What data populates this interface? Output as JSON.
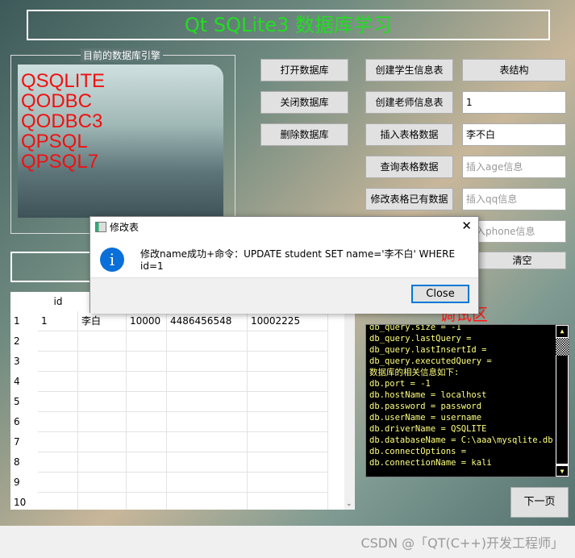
{
  "title": "Qt SQLite3 数据库学习",
  "engine_group": {
    "label": "目前的数据库引擎",
    "drivers": [
      "QSQLITE",
      "QODBC",
      "QODBC3",
      "QPSQL",
      "QPSQL7"
    ]
  },
  "buttons": {
    "open_db": "打开数据库",
    "close_db": "关闭数据库",
    "delete_db": "删除数据库",
    "create_student": "创建学生信息表",
    "create_teacher": "创建老师信息表",
    "insert": "插入表格数据",
    "query": "查询表格数据",
    "update": "修改表格已有数据",
    "structure": "表结构",
    "clear": "清空",
    "next_page": "下一页"
  },
  "inputs": {
    "id": "1",
    "name": "李不白",
    "age_placeholder": "插入age信息",
    "qq_placeholder": "插入qq信息",
    "phone_placeholder": "插入phone信息"
  },
  "table": {
    "headers": [
      "id",
      "",
      "",
      "",
      ""
    ],
    "rows": [
      [
        "1",
        "李白",
        "10000",
        "4486456548",
        "10002225"
      ]
    ],
    "row_numbers": [
      "1",
      "2",
      "3",
      "4",
      "5",
      "6",
      "7",
      "8",
      "9",
      "10"
    ]
  },
  "debug": {
    "label": "调试区",
    "lines": [
      "db_query.size = -1",
      "db_query.lastQuery =",
      "db_query.lastInsertId =",
      "db_query.executedQuery =",
      "数据库的相关信息如下:",
      "db.port = -1",
      "db.hostName = localhost",
      "db.password = password",
      "db.userName = username",
      "db.driverName = QSQLITE",
      "db.databaseName = C:\\aaa\\mysqlite.db",
      "db.connectOptions =",
      "db.connectionName = kali"
    ]
  },
  "dialog": {
    "title": "修改表",
    "message": "修改name成功+命令：UPDATE student SET name='李不白' WHERE id=1",
    "close": "Close",
    "close_x": "✕"
  },
  "watermark": "CSDN @「QT(C++)开发工程师」"
}
